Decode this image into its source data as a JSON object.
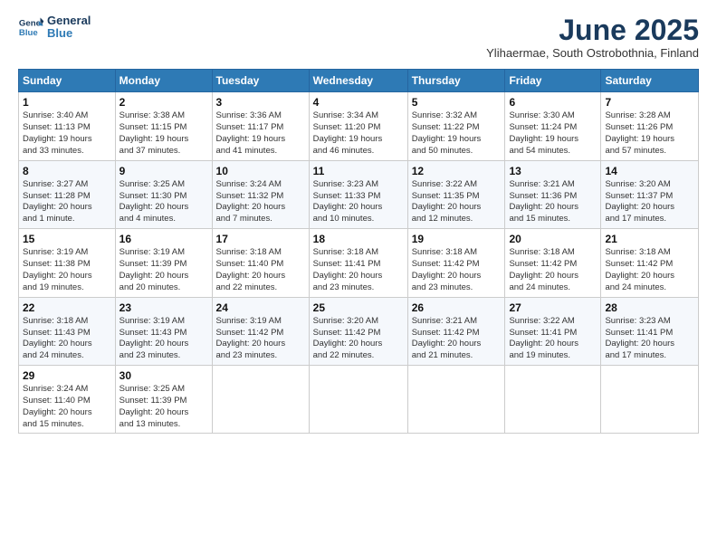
{
  "header": {
    "logo_line1": "General",
    "logo_line2": "Blue",
    "month": "June 2025",
    "location": "Ylihaermae, South Ostrobothnia, Finland"
  },
  "days_of_week": [
    "Sunday",
    "Monday",
    "Tuesday",
    "Wednesday",
    "Thursday",
    "Friday",
    "Saturday"
  ],
  "weeks": [
    [
      {
        "day": "1",
        "info": "Sunrise: 3:40 AM\nSunset: 11:13 PM\nDaylight: 19 hours\nand 33 minutes."
      },
      {
        "day": "2",
        "info": "Sunrise: 3:38 AM\nSunset: 11:15 PM\nDaylight: 19 hours\nand 37 minutes."
      },
      {
        "day": "3",
        "info": "Sunrise: 3:36 AM\nSunset: 11:17 PM\nDaylight: 19 hours\nand 41 minutes."
      },
      {
        "day": "4",
        "info": "Sunrise: 3:34 AM\nSunset: 11:20 PM\nDaylight: 19 hours\nand 46 minutes."
      },
      {
        "day": "5",
        "info": "Sunrise: 3:32 AM\nSunset: 11:22 PM\nDaylight: 19 hours\nand 50 minutes."
      },
      {
        "day": "6",
        "info": "Sunrise: 3:30 AM\nSunset: 11:24 PM\nDaylight: 19 hours\nand 54 minutes."
      },
      {
        "day": "7",
        "info": "Sunrise: 3:28 AM\nSunset: 11:26 PM\nDaylight: 19 hours\nand 57 minutes."
      }
    ],
    [
      {
        "day": "8",
        "info": "Sunrise: 3:27 AM\nSunset: 11:28 PM\nDaylight: 20 hours\nand 1 minute."
      },
      {
        "day": "9",
        "info": "Sunrise: 3:25 AM\nSunset: 11:30 PM\nDaylight: 20 hours\nand 4 minutes."
      },
      {
        "day": "10",
        "info": "Sunrise: 3:24 AM\nSunset: 11:32 PM\nDaylight: 20 hours\nand 7 minutes."
      },
      {
        "day": "11",
        "info": "Sunrise: 3:23 AM\nSunset: 11:33 PM\nDaylight: 20 hours\nand 10 minutes."
      },
      {
        "day": "12",
        "info": "Sunrise: 3:22 AM\nSunset: 11:35 PM\nDaylight: 20 hours\nand 12 minutes."
      },
      {
        "day": "13",
        "info": "Sunrise: 3:21 AM\nSunset: 11:36 PM\nDaylight: 20 hours\nand 15 minutes."
      },
      {
        "day": "14",
        "info": "Sunrise: 3:20 AM\nSunset: 11:37 PM\nDaylight: 20 hours\nand 17 minutes."
      }
    ],
    [
      {
        "day": "15",
        "info": "Sunrise: 3:19 AM\nSunset: 11:38 PM\nDaylight: 20 hours\nand 19 minutes."
      },
      {
        "day": "16",
        "info": "Sunrise: 3:19 AM\nSunset: 11:39 PM\nDaylight: 20 hours\nand 20 minutes."
      },
      {
        "day": "17",
        "info": "Sunrise: 3:18 AM\nSunset: 11:40 PM\nDaylight: 20 hours\nand 22 minutes."
      },
      {
        "day": "18",
        "info": "Sunrise: 3:18 AM\nSunset: 11:41 PM\nDaylight: 20 hours\nand 23 minutes."
      },
      {
        "day": "19",
        "info": "Sunrise: 3:18 AM\nSunset: 11:42 PM\nDaylight: 20 hours\nand 23 minutes."
      },
      {
        "day": "20",
        "info": "Sunrise: 3:18 AM\nSunset: 11:42 PM\nDaylight: 20 hours\nand 24 minutes."
      },
      {
        "day": "21",
        "info": "Sunrise: 3:18 AM\nSunset: 11:42 PM\nDaylight: 20 hours\nand 24 minutes."
      }
    ],
    [
      {
        "day": "22",
        "info": "Sunrise: 3:18 AM\nSunset: 11:43 PM\nDaylight: 20 hours\nand 24 minutes."
      },
      {
        "day": "23",
        "info": "Sunrise: 3:19 AM\nSunset: 11:43 PM\nDaylight: 20 hours\nand 23 minutes."
      },
      {
        "day": "24",
        "info": "Sunrise: 3:19 AM\nSunset: 11:42 PM\nDaylight: 20 hours\nand 23 minutes."
      },
      {
        "day": "25",
        "info": "Sunrise: 3:20 AM\nSunset: 11:42 PM\nDaylight: 20 hours\nand 22 minutes."
      },
      {
        "day": "26",
        "info": "Sunrise: 3:21 AM\nSunset: 11:42 PM\nDaylight: 20 hours\nand 21 minutes."
      },
      {
        "day": "27",
        "info": "Sunrise: 3:22 AM\nSunset: 11:41 PM\nDaylight: 20 hours\nand 19 minutes."
      },
      {
        "day": "28",
        "info": "Sunrise: 3:23 AM\nSunset: 11:41 PM\nDaylight: 20 hours\nand 17 minutes."
      }
    ],
    [
      {
        "day": "29",
        "info": "Sunrise: 3:24 AM\nSunset: 11:40 PM\nDaylight: 20 hours\nand 15 minutes."
      },
      {
        "day": "30",
        "info": "Sunrise: 3:25 AM\nSunset: 11:39 PM\nDaylight: 20 hours\nand 13 minutes."
      },
      {
        "day": "",
        "info": ""
      },
      {
        "day": "",
        "info": ""
      },
      {
        "day": "",
        "info": ""
      },
      {
        "day": "",
        "info": ""
      },
      {
        "day": "",
        "info": ""
      }
    ]
  ]
}
